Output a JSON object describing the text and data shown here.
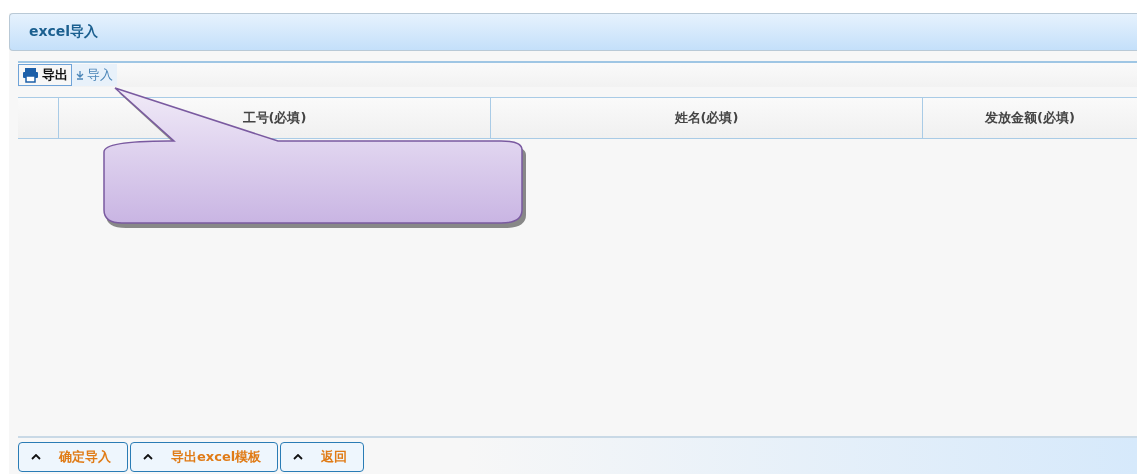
{
  "panel": {
    "title": "excel导入"
  },
  "toolbar": [
    {
      "label": "导出",
      "kind": "print"
    },
    {
      "label": "导入",
      "kind": "download"
    }
  ],
  "table": {
    "columns": [
      "工号(必填)",
      "姓名(必填)",
      "发放金额(必填)"
    ]
  },
  "buttons": [
    "确定导入",
    "导出excel模板",
    "返回"
  ]
}
